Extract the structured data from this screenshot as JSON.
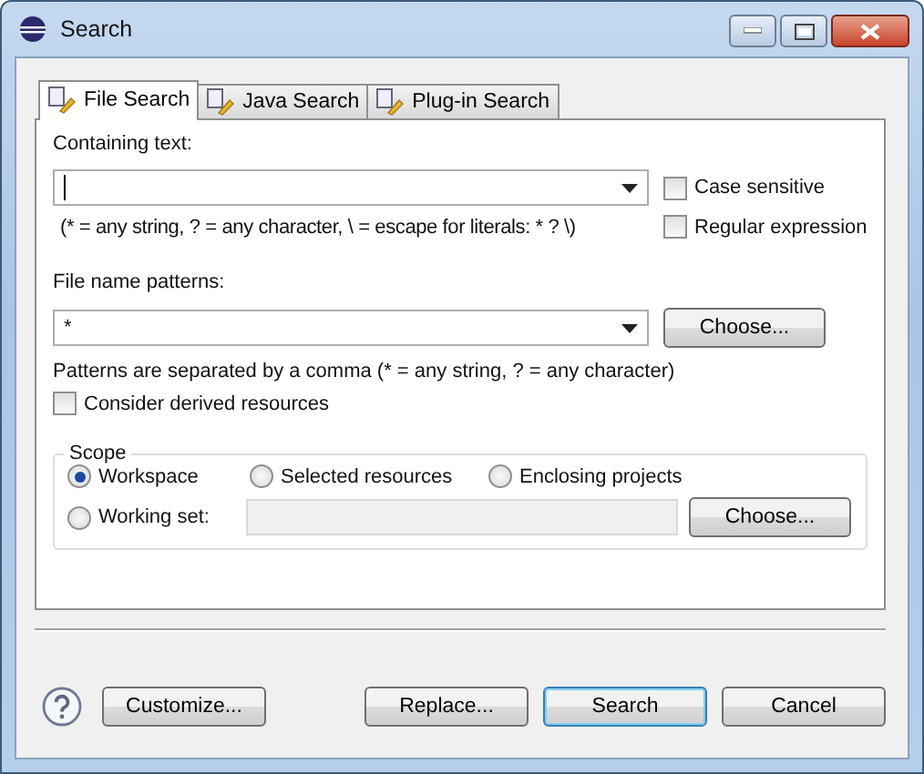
{
  "window": {
    "title": "Search"
  },
  "tabs": [
    {
      "label": "File Search",
      "selected": true
    },
    {
      "label": "Java Search",
      "selected": false
    },
    {
      "label": "Plug-in Search",
      "selected": false
    }
  ],
  "containing_text": {
    "label": "Containing text:",
    "focused": true
  },
  "case_sensitive": {
    "label": "Case sensitive",
    "checked": false
  },
  "literal_hint": "(* = any string, ? = any character, \\ = escape for literals: * ? \\)",
  "regular_expression": {
    "label": "Regular expression",
    "checked": false
  },
  "file_name_patterns": {
    "label": "File name patterns:",
    "value": "*",
    "button": "Choose..."
  },
  "patterns_hint": "Patterns are separated by a comma (* = any string, ? = any character)",
  "consider_derived": {
    "label": "Consider derived resources",
    "checked": false
  },
  "scope": {
    "title": "Scope",
    "options": [
      {
        "label": "Workspace",
        "selected": true
      },
      {
        "label": "Selected resources",
        "selected": false
      },
      {
        "label": "Enclosing projects",
        "selected": false
      },
      {
        "label": "Working set:",
        "selected": false
      }
    ],
    "working_set": {
      "disabled": true
    },
    "button": "Choose..."
  },
  "buttons": [
    {
      "label": "Customize...",
      "default": false
    },
    {
      "label": "Replace...",
      "default": false
    },
    {
      "label": "Search",
      "default": true
    },
    {
      "label": "Cancel",
      "default": false
    }
  ]
}
